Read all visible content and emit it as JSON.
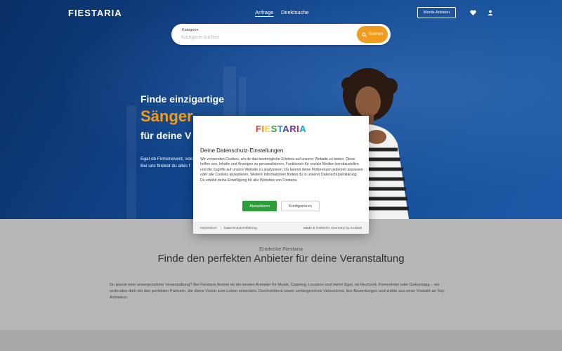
{
  "header": {
    "logo": "FIESTARIA",
    "nav": [
      "Anfrage",
      "Direktsuche"
    ],
    "become_provider": "Werde Anbieter",
    "icons": [
      "heart-icon",
      "user-icon"
    ]
  },
  "search": {
    "label": "Kategorie",
    "placeholder": "Kategorie suchen",
    "button": "Suchen",
    "icon": "search-icon"
  },
  "hero": {
    "line1": "Finde einzigartige",
    "line2": "Sänger",
    "line3": "für deine V",
    "desc_line1": "Egal ob Firmenevent, ode",
    "desc_line2": "Bei uns findest du alles f"
  },
  "section": {
    "eyebrow": "Entdecke Fiestaria",
    "title": "Finde den perfekten Anbieter für deine Veranstaltung",
    "text": "Du planst eine unvergessliche Veranstaltung? Bei Fiestaria findest du die besten Anbieter für Musik, Catering, Location und mehr! Egal, ob Hochzeit, Firmenfeier oder Geburtstag – wir verbinden dich mit den perfekten Partnern, die deine Vision zum Leben erwecken. Durchstöbere unser umfangreiches Verzeichnis, lies Bewertungen und wähle aus einer Vielzahl an Top-Anbietern."
  },
  "cookie_modal": {
    "logo_letters": [
      "F",
      "I",
      "E",
      "S",
      "T",
      "A",
      "R",
      "I",
      "A"
    ],
    "logo_colors": [
      "#e53935",
      "#fb8c00",
      "#fdd835",
      "#43a047",
      "#1e88e5",
      "#3949ab",
      "#8e24aa",
      "#d81b60",
      "#00acc1"
    ],
    "title": "Deine Datenschutz-Einstellungen",
    "body": "Wir verwenden Cookies, um dir das bestmögliche Erlebnis auf unserer Website zu bieten. Diese helfen uns, Inhalte und Anzeigen zu personalisieren, Funktionen für soziale Medien bereitzustellen und die Zugriffe auf unsere Website zu analysieren. Du kannst deine Präferenzen jederzeit anpassen oder alle Cookies akzeptieren. Weitere Informationen findest du in unserer Datenschutzerklärung. Du erteilst deine Einwilligung für alle Websites von Fiestaria.",
    "accept": "Akzeptieren",
    "configure": "Konfigurieren",
    "footer_links": [
      "Impressum",
      "Datenschutzerklärung"
    ],
    "footer_right": "Made & Hosted in Germany by CCM19"
  },
  "colors": {
    "accent": "#f29c1f",
    "accept_green": "#2e9e3a",
    "hero_blue": "#10448a"
  }
}
